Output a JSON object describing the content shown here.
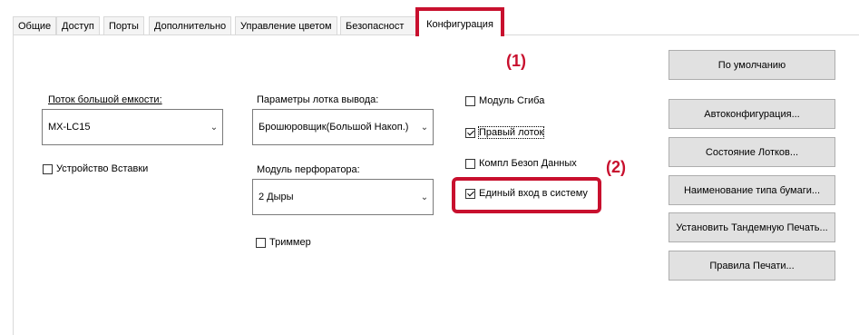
{
  "tabs": [
    {
      "label": "Общие"
    },
    {
      "label": "Доступ"
    },
    {
      "label": "Порты"
    },
    {
      "label": "Дополнительно"
    },
    {
      "label": "Управление цветом"
    },
    {
      "label": "Безопасност"
    },
    {
      "label": "Конфигурация",
      "active": true
    }
  ],
  "callouts": {
    "one": "(1)",
    "two": "(2)"
  },
  "fields": {
    "high_capacity_tray": {
      "label": "Поток большой емкости:",
      "value": "MX-LC15"
    },
    "output_tray_params": {
      "label": "Параметры лотка вывода:",
      "value": "Брошюровщик(Большой Накоп.)"
    },
    "punch_module": {
      "label": "Модуль перфоратора:",
      "value": "2 Дыры"
    }
  },
  "checkboxes": {
    "insert_device": {
      "label": "Устройство Вставки",
      "checked": false
    },
    "trimmer": {
      "label": "Триммер",
      "checked": false
    },
    "fold_module": {
      "label": "Модуль Сгиба",
      "checked": false
    },
    "right_tray": {
      "label": "Правый лоток",
      "checked": true
    },
    "data_security_kit": {
      "label": "Компл Безоп Данных",
      "checked": false
    },
    "single_sign_on": {
      "label": "Единый вход в систему",
      "checked": true
    }
  },
  "buttons": {
    "defaults": "По умолчанию",
    "auto_config": "Автоконфигурация...",
    "tray_status": "Состояние Лотков...",
    "paper_type_names": "Наименование типа бумаги...",
    "tandem_print": "Установить Тандемную Печать...",
    "print_rules": "Правила Печати..."
  },
  "colors": {
    "highlight": "#c8102e",
    "button_bg": "#e1e1e1"
  }
}
